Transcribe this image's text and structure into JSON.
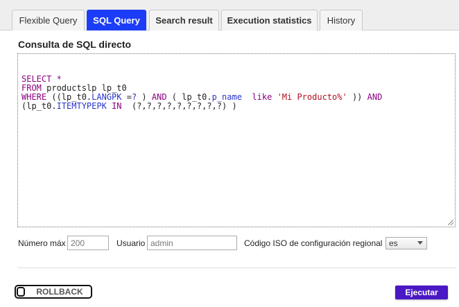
{
  "tabs": [
    {
      "label": "Flexible Query"
    },
    {
      "label": "SQL Query"
    },
    {
      "label": "Search result"
    },
    {
      "label": "Execution statistics"
    },
    {
      "label": "History"
    }
  ],
  "section": {
    "title": "Consulta de SQL directo"
  },
  "sql": {
    "lines": [
      [
        {
          "t": "kw",
          "v": "SELECT *"
        }
      ],
      [
        {
          "t": "kw",
          "v": "FROM "
        },
        {
          "t": "idn",
          "v": "productslp lp_t0"
        }
      ],
      [
        {
          "t": "kw",
          "v": "WHERE "
        },
        {
          "t": "idn",
          "v": "((lp_t0."
        },
        {
          "t": "col",
          "v": "LANGPK"
        },
        {
          "t": "idn",
          "v": " ="
        },
        {
          "t": "col",
          "v": "?"
        },
        {
          "t": "idn",
          "v": " ) "
        },
        {
          "t": "kw",
          "v": "AND"
        },
        {
          "t": "idn",
          "v": " ( lp_t0."
        },
        {
          "t": "col",
          "v": "p_name"
        },
        {
          "t": "idn",
          "v": "  "
        },
        {
          "t": "kw",
          "v": "like"
        },
        {
          "t": "idn",
          "v": " "
        },
        {
          "t": "str",
          "v": "'Mi Producto%'"
        },
        {
          "t": "idn",
          "v": " )) "
        },
        {
          "t": "kw",
          "v": "AND"
        }
      ],
      [
        {
          "t": "idn",
          "v": "(lp_t0."
        },
        {
          "t": "col",
          "v": "ITEMTYPEPK"
        },
        {
          "t": "idn",
          "v": " "
        },
        {
          "t": "kw",
          "v": "IN"
        },
        {
          "t": "idn",
          "v": "  (?,?,?,?,?,?,?,?,?) )"
        }
      ]
    ]
  },
  "form": {
    "max_label": "Número máx",
    "max_value": "200",
    "user_label": "Usuario",
    "user_value": "admin",
    "locale_label": "Código ISO de configuración regional",
    "locale_value": "es"
  },
  "buttons": {
    "rollback": "ROLLBACK",
    "execute": "Ejecutar"
  }
}
